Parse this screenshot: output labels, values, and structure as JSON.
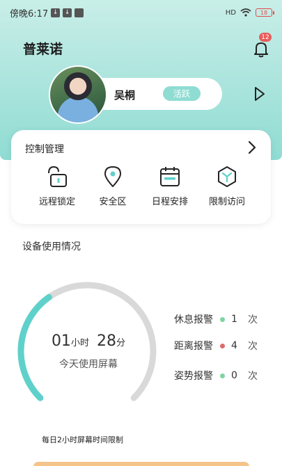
{
  "status_bar": {
    "time": "傍晚6:17",
    "network": "HD",
    "battery": "18"
  },
  "header": {
    "title": "普莱诺",
    "notification_count": "12"
  },
  "profile": {
    "name": "吴桐",
    "status": "活跃"
  },
  "control": {
    "title": "控制管理",
    "items": [
      {
        "label": "远程锁定",
        "icon": "unlock-icon"
      },
      {
        "label": "安全区",
        "icon": "location-pin-icon"
      },
      {
        "label": "日程安排",
        "icon": "calendar-icon"
      },
      {
        "label": "限制访问",
        "icon": "restrict-icon"
      }
    ]
  },
  "usage": {
    "title": "设备使用情况",
    "hours": "01",
    "hours_unit": "小时",
    "minutes": "28",
    "minutes_unit": "分",
    "label": "今天使用屏幕",
    "progress": 0.37,
    "limit_note": "每日2小时屏幕时间限制",
    "alarms": [
      {
        "name": "休息报警",
        "count": "1",
        "unit": "次",
        "dot_color": "#7fd3a0"
      },
      {
        "name": "距离报警",
        "count": "4",
        "unit": "次",
        "dot_color": "#e06b6b"
      },
      {
        "name": "姿势报警",
        "count": "0",
        "unit": "次",
        "dot_color": "#7fd3a0"
      }
    ]
  },
  "colors": {
    "accent": "#8fdcd3",
    "gauge_fill": "#5fd1cb",
    "gauge_track": "#d9d9d9"
  }
}
